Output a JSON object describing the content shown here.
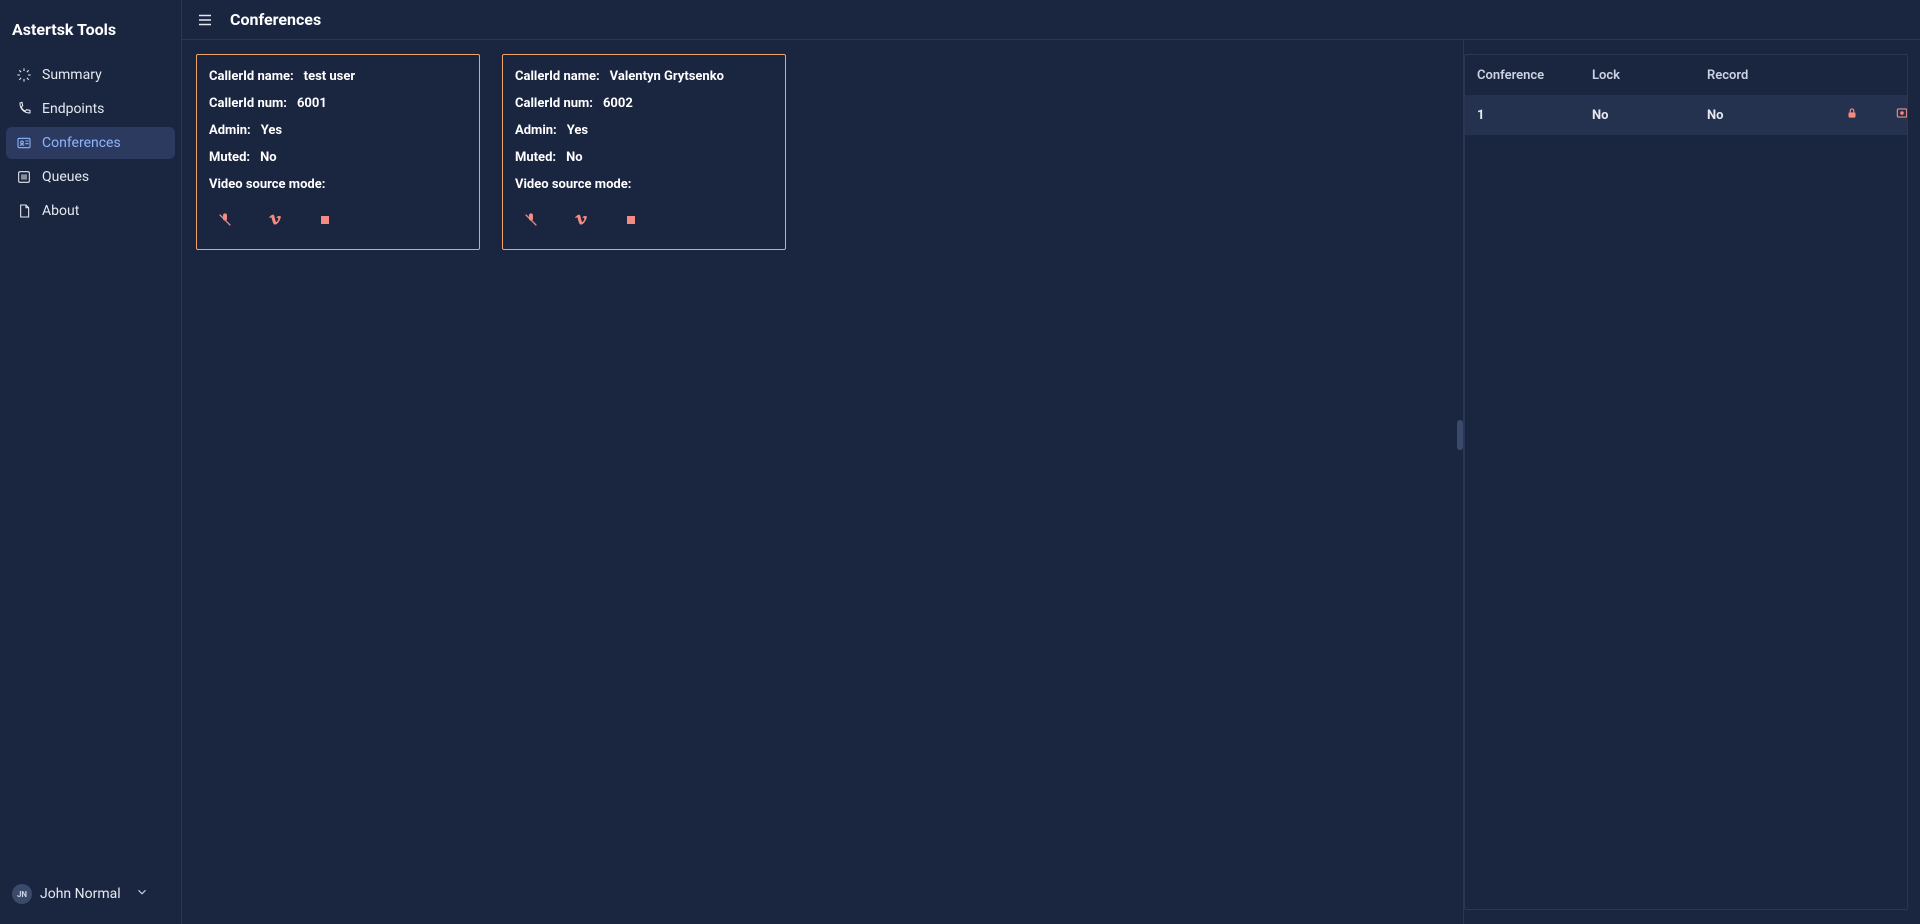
{
  "brand": "Astertsk Tools",
  "nav": [
    {
      "key": "summary",
      "label": "Summary"
    },
    {
      "key": "endpoints",
      "label": "Endpoints"
    },
    {
      "key": "conferences",
      "label": "Conferences"
    },
    {
      "key": "queues",
      "label": "Queues"
    },
    {
      "key": "about",
      "label": "About"
    }
  ],
  "nav_active": "conferences",
  "user": {
    "initials": "JN",
    "name": "John Normal"
  },
  "page_title": "Conferences",
  "field_labels": {
    "callerid_name": "CallerId name:",
    "callerid_num": "CallerId num:",
    "admin": "Admin:",
    "muted": "Muted:",
    "video_mode": "Video source mode:"
  },
  "participants": [
    {
      "callerid_name": "test user",
      "callerid_num": "6001",
      "admin": "Yes",
      "muted": "No",
      "video_mode": ""
    },
    {
      "callerid_name": "Valentyn Grytsenko",
      "callerid_num": "6002",
      "admin": "Yes",
      "muted": "No",
      "video_mode": ""
    }
  ],
  "table": {
    "headers": {
      "conference": "Conference",
      "lock": "Lock",
      "record": "Record"
    },
    "rows": [
      {
        "conference": "1",
        "lock": "No",
        "record": "No"
      }
    ]
  },
  "colors": {
    "bg": "#1a2540",
    "panel_border": "#2a3654",
    "active_nav_bg": "#2b3a5e",
    "active_nav_fg": "#8fb6ff",
    "card_border": "#f0a36b",
    "action_icon": "#f28b82",
    "row_bg": "#24314f"
  },
  "icons": {
    "mute": "microphone-slash-icon",
    "video": "vimeo-icon",
    "stop": "stop-icon",
    "lock": "lock-icon",
    "record_box": "record-box-icon"
  }
}
